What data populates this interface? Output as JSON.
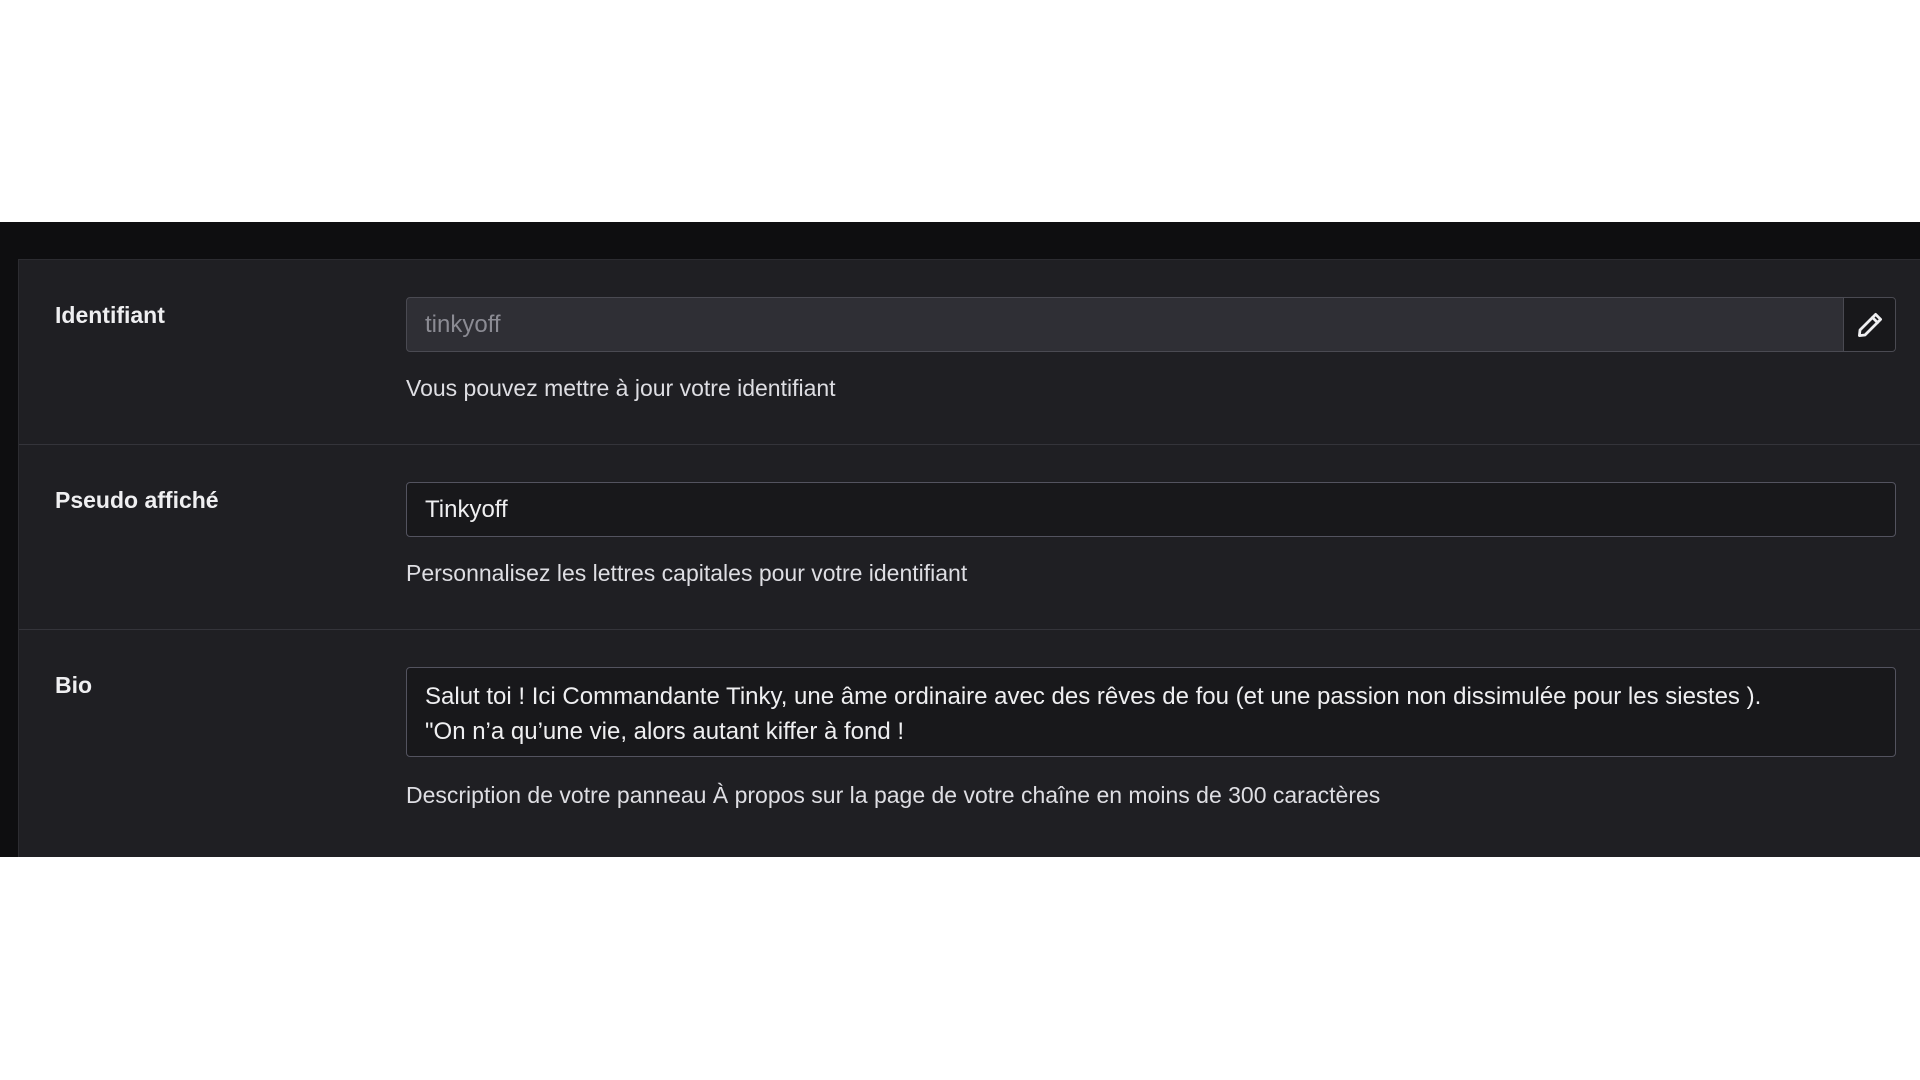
{
  "settings": {
    "username": {
      "label": "Identifiant",
      "value": "tinkyoff",
      "help": "Vous pouvez mettre à jour votre identifiant",
      "edit_icon": "pencil-icon"
    },
    "display_name": {
      "label": "Pseudo affiché",
      "value": "Tinkyoff",
      "help": "Personnalisez les lettres capitales pour votre identifiant"
    },
    "bio": {
      "label": "Bio",
      "value": "Salut toi ! Ici Commandante Tinky, une âme ordinaire avec des rêves de fou (et une passion non dissimulée pour les siestes ).\n\"On n’a qu’une vie, alors autant kiffer à fond !",
      "help": "Description de votre panneau À propos sur la page de votre chaîne en moins de 300 caractères"
    }
  },
  "colors": {
    "page_background": "#0e0e10",
    "panel_background": "#1f1f23",
    "input_background": "#18181b",
    "readonly_background": "#2f2f35",
    "text_primary": "#efeff1",
    "text_muted": "#8b8b93"
  }
}
